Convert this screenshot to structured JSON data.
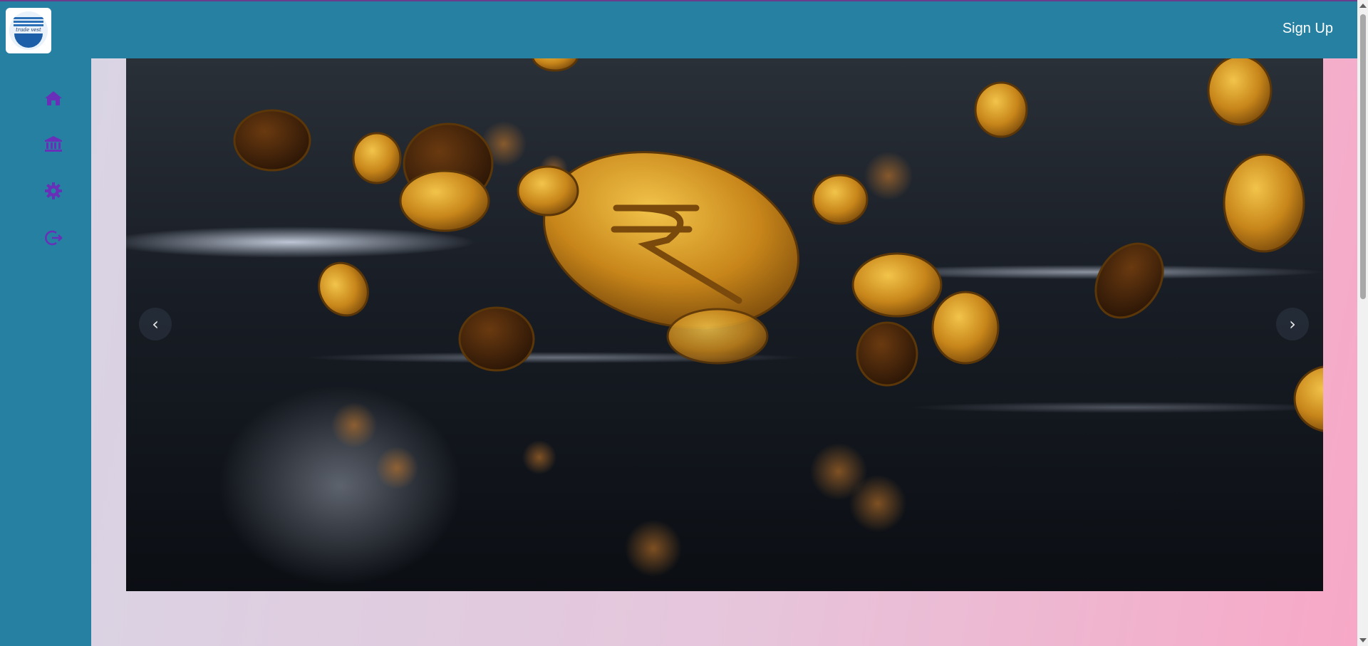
{
  "header": {
    "logo_text": "trade vest",
    "signup_label": "Sign Up"
  },
  "sidebar": {
    "items": [
      {
        "icon": "home-icon"
      },
      {
        "icon": "bank-icon"
      },
      {
        "icon": "gear-icon"
      },
      {
        "icon": "logout-icon"
      }
    ],
    "icon_color": "#6a2fb8"
  },
  "carousel": {
    "prev_label": "‹",
    "next_label": "›",
    "image_subject": "golden rupee coins"
  },
  "colors": {
    "header_bg": "#2580a2",
    "sidebar_bg": "#2580a2",
    "coin_gold": "#d4951a"
  }
}
